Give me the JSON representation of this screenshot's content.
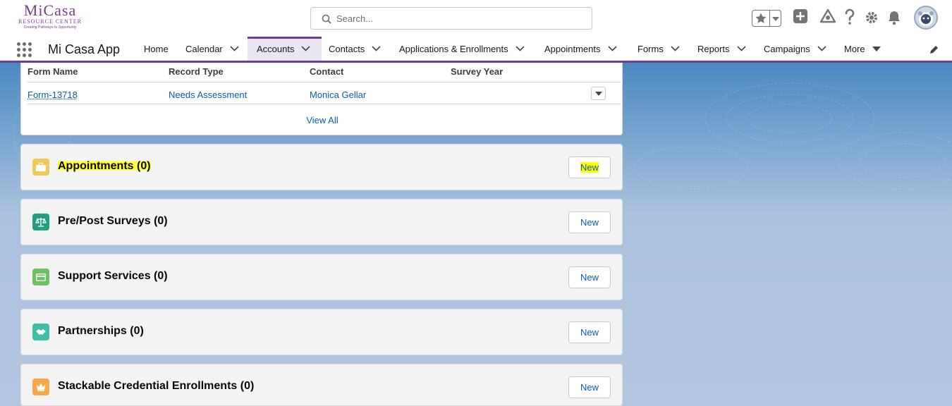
{
  "logo": {
    "line1": "MiCasa",
    "line2": "RESOURCE CENTER",
    "tagline": "Creating Pathways to Opportunity"
  },
  "search": {
    "placeholder": "Search..."
  },
  "header_icons": [
    "star-icon",
    "add-icon",
    "trailhead-icon",
    "help-icon",
    "setup-gear-icon",
    "notifications-bell-icon",
    "avatar"
  ],
  "app": {
    "name": "Mi Casa App"
  },
  "nav": {
    "home": "Home",
    "calendar": "Calendar",
    "accounts": "Accounts",
    "contacts": "Contacts",
    "applications": "Applications & Enrollments",
    "appointments": "Appointments",
    "forms": "Forms",
    "reports": "Reports",
    "campaigns": "Campaigns",
    "more": "More"
  },
  "forms_table": {
    "columns": [
      "Form Name",
      "Record Type",
      "Contact",
      "Survey Year"
    ],
    "rows": [
      {
        "form_name": "Form-13718",
        "record_type": "Needs Assessment",
        "contact": "Monica Gellar",
        "survey_year": ""
      }
    ],
    "view_all": "View All"
  },
  "related_lists": [
    {
      "title": "Appointments (0)",
      "icon": "appointment-briefcase-icon",
      "color": "#f0c95a",
      "new_label": "New",
      "highlighted": true
    },
    {
      "title": "Pre/Post Surveys (0)",
      "icon": "survey-scales-icon",
      "color": "#239e7e",
      "new_label": "New"
    },
    {
      "title": "Support Services (0)",
      "icon": "support-services-card-icon",
      "color": "#6cc263",
      "new_label": "New"
    },
    {
      "title": "Partnerships (0)",
      "icon": "partnerships-handshake-icon",
      "color": "#3fbfa8",
      "new_label": "New"
    },
    {
      "title": "Stackable Credential Enrollments (0)",
      "icon": "credential-crown-icon",
      "color": "#f5a94a",
      "new_label": "New"
    }
  ],
  "colors": {
    "brand_purple": "#6c3f8f",
    "link_blue": "#0b5cab",
    "highlight": "#ffff00"
  }
}
